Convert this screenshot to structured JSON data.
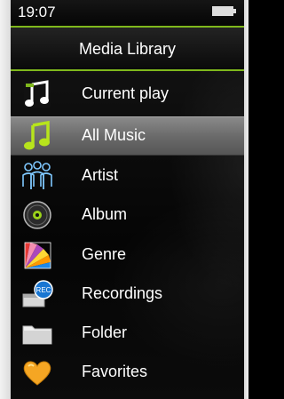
{
  "status": {
    "time": "19:07",
    "battery_icon": "battery-full-icon"
  },
  "header": {
    "title": "Media Library"
  },
  "menu": {
    "items": [
      {
        "label": "Current play",
        "icon": "music-note-icon"
      },
      {
        "label": "All Music",
        "icon": "music-note-green-icon"
      },
      {
        "label": "Artist",
        "icon": "people-icon"
      },
      {
        "label": "Album",
        "icon": "disc-icon"
      },
      {
        "label": "Genre",
        "icon": "color-fan-icon"
      },
      {
        "label": "Recordings",
        "icon": "rec-icon"
      },
      {
        "label": "Folder",
        "icon": "folder-icon"
      },
      {
        "label": "Favorites",
        "icon": "heart-icon"
      }
    ],
    "selected_index": 1
  },
  "colors": {
    "accent": "#7fb81c",
    "selected": "#6b6b6b"
  }
}
